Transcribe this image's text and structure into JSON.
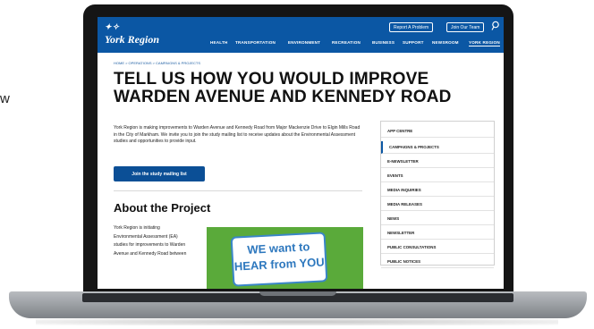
{
  "fragment": "w",
  "site": {
    "logo": "York Region",
    "utility": [
      "Report A Problem",
      "Join Our Team"
    ],
    "nav": [
      "HEALTH",
      "TRANSPORTATION",
      "ENVIRONMENT",
      "RECREATION",
      "BUSINESS",
      "SUPPORT",
      "NEWSROOM",
      "YORK REGION"
    ]
  },
  "breadcrumb": "HOME  >  OPERATIONS  >  CAMPAIGNS & PROJECTS",
  "page": {
    "title": "TELL US HOW YOU WOULD IMPROVE WARDEN AVENUE AND KENNEDY ROAD",
    "intro": "York Region is making improvements to Warden Avenue and Kennedy Road from Major Mackenzie Drive to Elgin Mills Road in the City of Markham. We invite you to join the study mailing list to receive updates about the Environmental Assessment studies and opportunities to provide input.",
    "cta": "Join the study mailing list",
    "about_heading": "About the Project",
    "about_text": "York Region is initiating Environmental Assessment (EA) studies for improvements to Warden Avenue and Kennedy Road between",
    "promo_line1": "WE want to",
    "promo_line2": "HEAR from YOU"
  },
  "sidebar": [
    "APP CENTRE",
    "CAMPAIGNS & PROJECTS",
    "E-NEWSLETTER",
    "EVENTS",
    "MEDIA INQUIRIES",
    "MEDIA RELEASES",
    "NEWS",
    "NEWSLETTER",
    "PUBLIC CONSULTATIONS",
    "PUBLIC NOTICES"
  ],
  "colors": {
    "brand": "#0b57a4",
    "promo": "#5aaa3a"
  }
}
